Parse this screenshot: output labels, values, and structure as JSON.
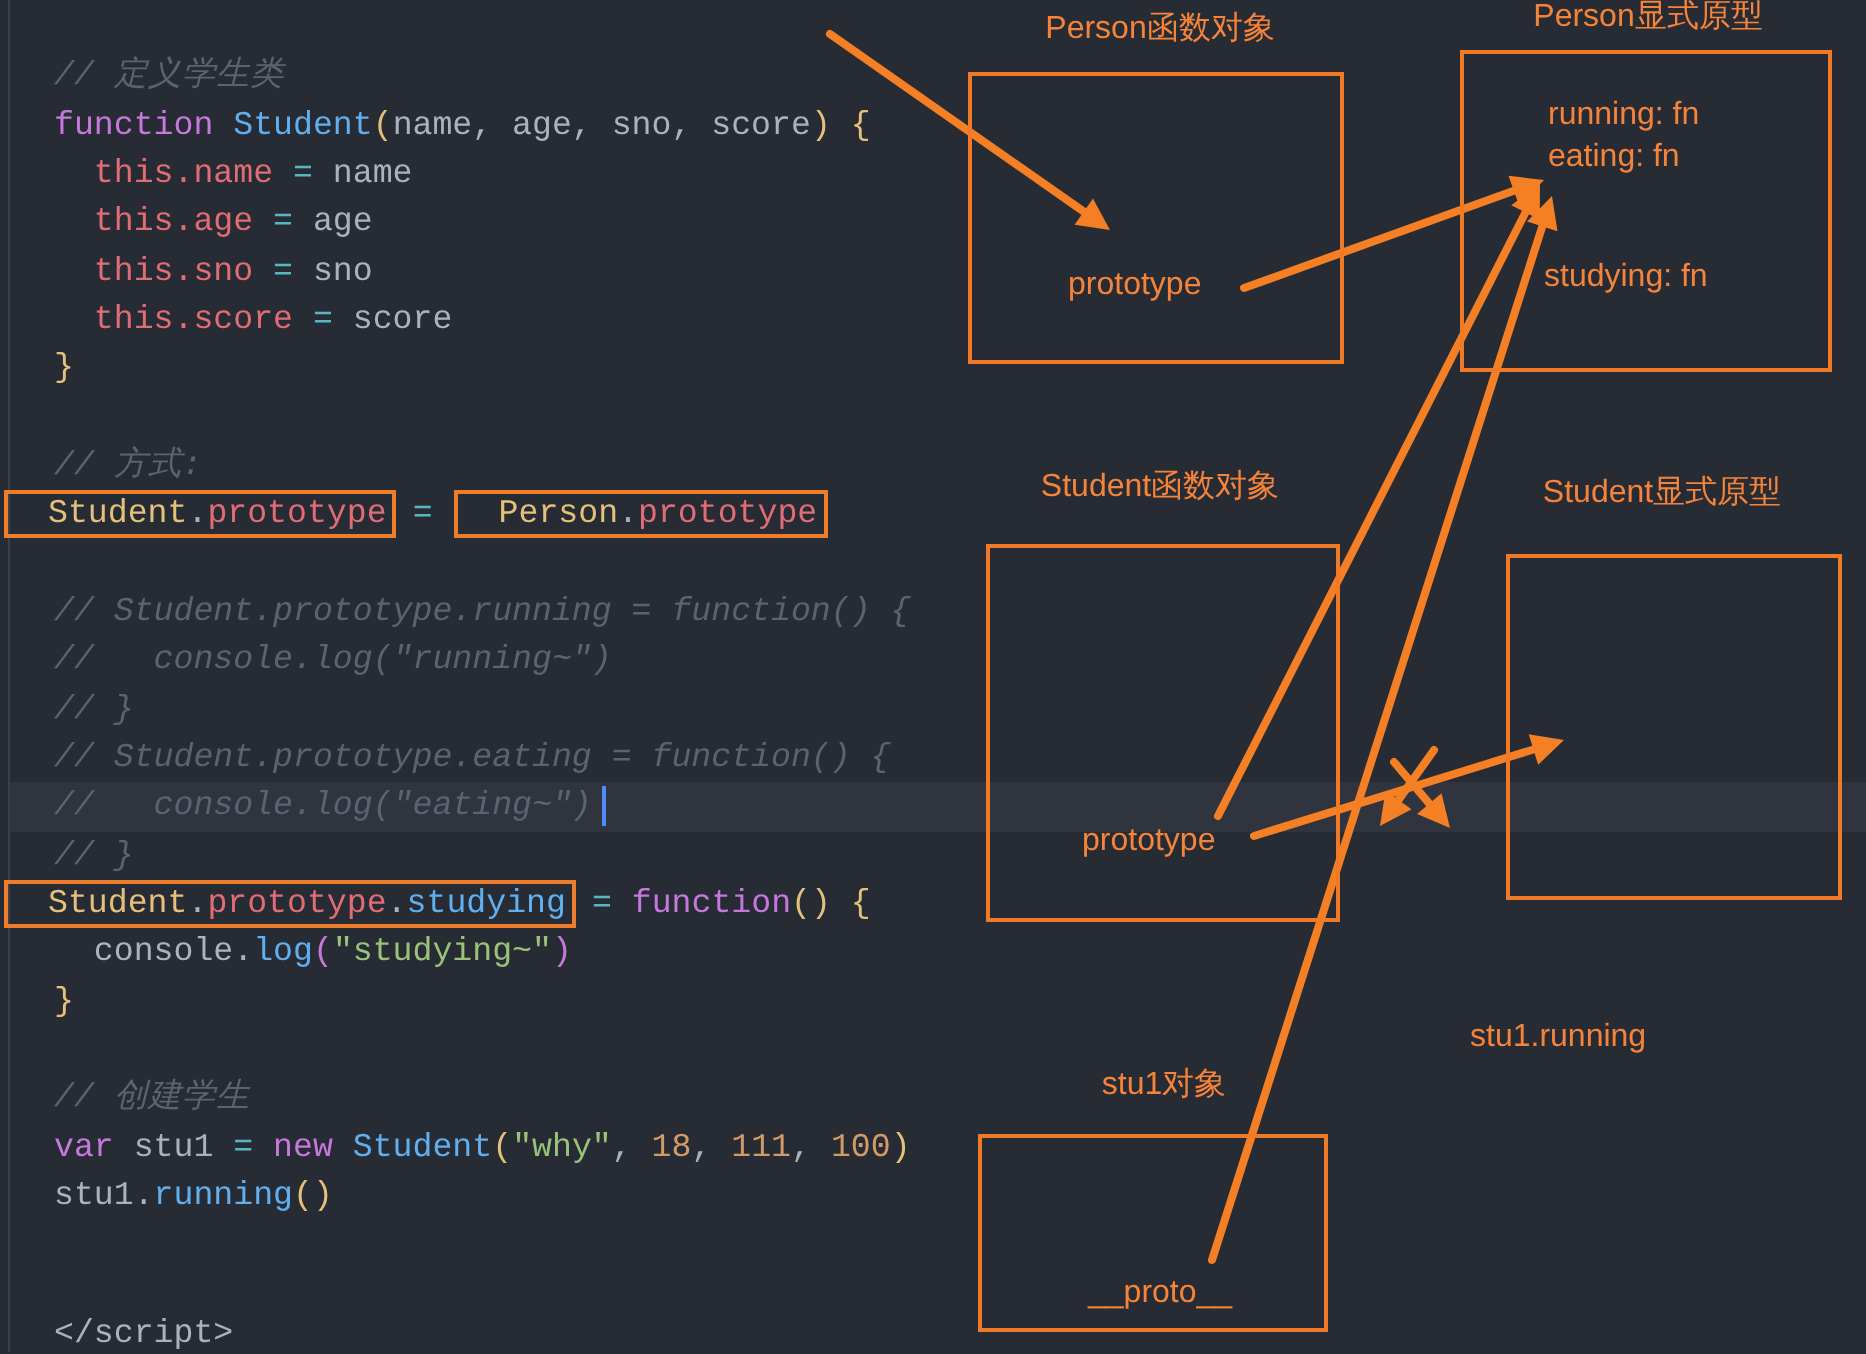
{
  "editor": {
    "lines": [
      {
        "kind": "code",
        "current": false,
        "segments": [
          {
            "boxed": false,
            "tokens": [
              {
                "kind": "comment",
                "text": "// 定义学生类"
              }
            ]
          }
        ]
      },
      {
        "kind": "code",
        "current": false,
        "segments": [
          {
            "boxed": false,
            "tokens": [
              {
                "kind": "keyword",
                "text": "function"
              },
              {
                "kind": "func",
                "text": " Student"
              },
              {
                "kind": "paren",
                "text": "("
              },
              {
                "kind": "plain",
                "text": "name, age, sno, score"
              },
              {
                "kind": "paren",
                "text": ") {"
              }
            ]
          }
        ]
      },
      {
        "kind": "code",
        "current": false,
        "segments": [
          {
            "boxed": false,
            "tokens": [
              {
                "kind": "prop",
                "text": "  this.name"
              },
              {
                "kind": "op",
                "text": " = "
              },
              {
                "kind": "plain",
                "text": "name"
              }
            ]
          }
        ]
      },
      {
        "kind": "code",
        "current": false,
        "segments": [
          {
            "boxed": false,
            "tokens": [
              {
                "kind": "prop",
                "text": "  this.age"
              },
              {
                "kind": "op",
                "text": " = "
              },
              {
                "kind": "plain",
                "text": "age"
              }
            ]
          }
        ]
      },
      {
        "kind": "code",
        "current": false,
        "segments": [
          {
            "boxed": false,
            "tokens": [
              {
                "kind": "prop",
                "text": "  this.sno"
              },
              {
                "kind": "op",
                "text": " = "
              },
              {
                "kind": "plain",
                "text": "sno"
              }
            ]
          }
        ]
      },
      {
        "kind": "code",
        "current": false,
        "segments": [
          {
            "boxed": false,
            "tokens": [
              {
                "kind": "prop",
                "text": "  this.score"
              },
              {
                "kind": "op",
                "text": " = "
              },
              {
                "kind": "plain",
                "text": "score"
              }
            ]
          }
        ]
      },
      {
        "kind": "code",
        "current": false,
        "segments": [
          {
            "boxed": false,
            "tokens": [
              {
                "kind": "paren",
                "text": "}"
              }
            ]
          }
        ]
      },
      {
        "kind": "blank"
      },
      {
        "kind": "code",
        "current": false,
        "segments": [
          {
            "boxed": false,
            "tokens": [
              {
                "kind": "comment",
                "text": "// 方式:"
              }
            ]
          }
        ]
      },
      {
        "kind": "code",
        "current": false,
        "segments": [
          {
            "boxed": true,
            "tokens": [
              {
                "kind": "class",
                "text": "Student"
              },
              {
                "kind": "plain",
                "text": "."
              },
              {
                "kind": "prop",
                "text": "prototype"
              }
            ]
          },
          {
            "boxed": false,
            "tokens": [
              {
                "kind": "op",
                "text": "="
              }
            ]
          },
          {
            "boxed": true,
            "tokens": [
              {
                "kind": "class",
                "text": "Person"
              },
              {
                "kind": "plain",
                "text": "."
              },
              {
                "kind": "prop",
                "text": "prototype"
              }
            ]
          }
        ]
      },
      {
        "kind": "blank"
      },
      {
        "kind": "code",
        "current": false,
        "segments": [
          {
            "boxed": false,
            "tokens": [
              {
                "kind": "comment",
                "text": "// Student.prototype.running = function() {"
              }
            ]
          }
        ]
      },
      {
        "kind": "code",
        "current": false,
        "segments": [
          {
            "boxed": false,
            "tokens": [
              {
                "kind": "comment",
                "text": "//   console.log(\"running~\")"
              }
            ]
          }
        ]
      },
      {
        "kind": "code",
        "current": false,
        "segments": [
          {
            "boxed": false,
            "tokens": [
              {
                "kind": "comment",
                "text": "// }"
              }
            ]
          }
        ]
      },
      {
        "kind": "code",
        "current": false,
        "segments": [
          {
            "boxed": false,
            "tokens": [
              {
                "kind": "comment",
                "text": "// Student.prototype.eating = function() {"
              }
            ]
          }
        ]
      },
      {
        "kind": "code",
        "current": true,
        "segments": [
          {
            "boxed": false,
            "tokens": [
              {
                "kind": "comment",
                "text": "//   console.log(\"eating~\")"
              }
            ]
          }
        ]
      },
      {
        "kind": "code",
        "current": false,
        "segments": [
          {
            "boxed": false,
            "tokens": [
              {
                "kind": "comment",
                "text": "// }"
              }
            ]
          }
        ]
      },
      {
        "kind": "code",
        "current": false,
        "segments": [
          {
            "boxed": true,
            "tokens": [
              {
                "kind": "class",
                "text": "Student"
              },
              {
                "kind": "plain",
                "text": "."
              },
              {
                "kind": "prop",
                "text": "prototype"
              },
              {
                "kind": "plain",
                "text": "."
              },
              {
                "kind": "func",
                "text": "studying"
              }
            ]
          },
          {
            "boxed": false,
            "tokens": [
              {
                "kind": "op",
                "text": "="
              },
              {
                "kind": "keyword",
                "text": " function"
              },
              {
                "kind": "paren",
                "text": "() {"
              }
            ]
          }
        ]
      },
      {
        "kind": "code",
        "current": false,
        "segments": [
          {
            "boxed": false,
            "tokens": [
              {
                "kind": "plain",
                "text": "  console."
              },
              {
                "kind": "func",
                "text": "log"
              },
              {
                "kind": "call",
                "text": "("
              },
              {
                "kind": "string",
                "text": "\"studying~\""
              },
              {
                "kind": "call",
                "text": ")"
              }
            ]
          }
        ]
      },
      {
        "kind": "code",
        "current": false,
        "segments": [
          {
            "boxed": false,
            "tokens": [
              {
                "kind": "paren",
                "text": "}"
              }
            ]
          }
        ]
      },
      {
        "kind": "blank"
      },
      {
        "kind": "code",
        "current": false,
        "segments": [
          {
            "boxed": false,
            "tokens": [
              {
                "kind": "comment",
                "text": "// 创建学生"
              }
            ]
          }
        ]
      },
      {
        "kind": "code",
        "current": false,
        "segments": [
          {
            "boxed": false,
            "tokens": [
              {
                "kind": "keyword",
                "text": "var"
              },
              {
                "kind": "plain",
                "text": " stu1 "
              },
              {
                "kind": "op",
                "text": "="
              },
              {
                "kind": "keyword",
                "text": " new"
              },
              {
                "kind": "func",
                "text": " Student"
              },
              {
                "kind": "paren",
                "text": "("
              },
              {
                "kind": "string",
                "text": "\"why\""
              },
              {
                "kind": "plain",
                "text": ", "
              },
              {
                "kind": "number",
                "text": "18"
              },
              {
                "kind": "plain",
                "text": ", "
              },
              {
                "kind": "number",
                "text": "111"
              },
              {
                "kind": "plain",
                "text": ", "
              },
              {
                "kind": "number",
                "text": "100"
              },
              {
                "kind": "paren",
                "text": ")"
              }
            ]
          }
        ]
      },
      {
        "kind": "code",
        "current": false,
        "segments": [
          {
            "boxed": false,
            "tokens": [
              {
                "kind": "plain",
                "text": "stu1."
              },
              {
                "kind": "func",
                "text": "running"
              },
              {
                "kind": "paren",
                "text": "()"
              }
            ]
          }
        ]
      },
      {
        "kind": "blank"
      },
      {
        "kind": "blank"
      },
      {
        "kind": "code",
        "current": false,
        "segments": [
          {
            "boxed": false,
            "tokens": [
              {
                "kind": "plain",
                "text": "</script>"
              }
            ]
          }
        ]
      }
    ]
  },
  "diagram": {
    "nodes": [
      {
        "title": "Person函数对象",
        "fields": [
          "prototype"
        ]
      },
      {
        "title": "Person显式原型",
        "fields": [
          "running: fn",
          "eating: fn",
          "studying: fn"
        ]
      },
      {
        "title": "Student函数对象",
        "fields": [
          "prototype"
        ]
      },
      {
        "title": "Student显式原型"
      },
      {
        "title": "stu1对象",
        "fields": [
          "__proto__"
        ]
      }
    ],
    "notes": [
      "stu1.running"
    ]
  }
}
